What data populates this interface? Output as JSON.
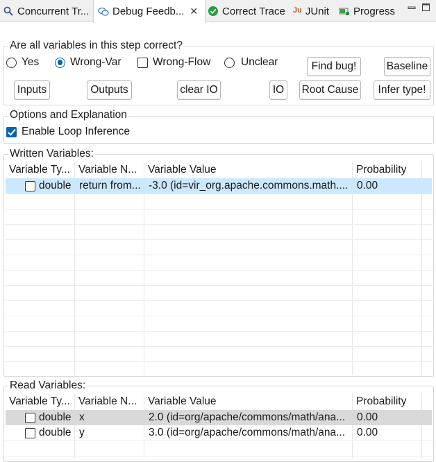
{
  "tabs": [
    {
      "label": "Concurrent Tr...",
      "icon": "search-icon",
      "active": false
    },
    {
      "label": "Debug Feedb...",
      "icon": "chat-bubbles-icon",
      "active": true,
      "close": "✕"
    },
    {
      "label": "Correct Trace",
      "icon": "green-check-icon",
      "active": false
    },
    {
      "label": "JUnit",
      "icon": "junit-icon",
      "icon_text": "Ju",
      "active": false
    },
    {
      "label": "Progress",
      "icon": "progress-icon",
      "active": false
    }
  ],
  "question": {
    "legend": "Are all variables in this step correct?",
    "options": [
      {
        "label": "Yes",
        "type": "radio",
        "checked": false
      },
      {
        "label": "Wrong-Var",
        "type": "radio",
        "checked": true
      },
      {
        "label": "Wrong-Flow",
        "type": "checkbox",
        "checked": false
      },
      {
        "label": "Unclear",
        "type": "radio",
        "checked": false
      }
    ],
    "buttons": {
      "find_bug": "Find bug!",
      "baseline": "Baseline",
      "inputs": "Inputs",
      "outputs": "Outputs",
      "clear_io": "clear IO",
      "io": "IO",
      "root_cause": "Root Cause",
      "infer_type": "Infer type!"
    }
  },
  "options_group": {
    "legend": "Options and Explanation",
    "enable_loop_inference": {
      "label": "Enable Loop Inference",
      "checked": true
    }
  },
  "written": {
    "legend": "Written Variables:",
    "columns": [
      "Variable Ty...",
      "Variable N...",
      "Variable Value",
      "Probability"
    ],
    "rows": [
      {
        "type": "double",
        "name": "return from...",
        "value": "-3.0 (id=vir_org.apache.commons.math....",
        "probability": "0.00",
        "checked": false
      }
    ]
  },
  "read": {
    "legend": "Read Variables:",
    "columns": [
      "Variable Ty...",
      "Variable N...",
      "Variable Value",
      "Probability"
    ],
    "rows": [
      {
        "type": "double",
        "name": "x",
        "value": "2.0 (id=org/apache/commons/math/ana...",
        "probability": "0.00",
        "checked": false
      },
      {
        "type": "double",
        "name": "y",
        "value": "3.0 (id=org/apache/commons/math/ana...",
        "probability": "0.00",
        "checked": false
      }
    ]
  },
  "colors": {
    "accent": "#0a64ad",
    "selected_row": "#cce8ff",
    "gray_row": "#d9d9d9",
    "junit_icon": "#b5561d",
    "check_icon": "#1e9e3e"
  }
}
